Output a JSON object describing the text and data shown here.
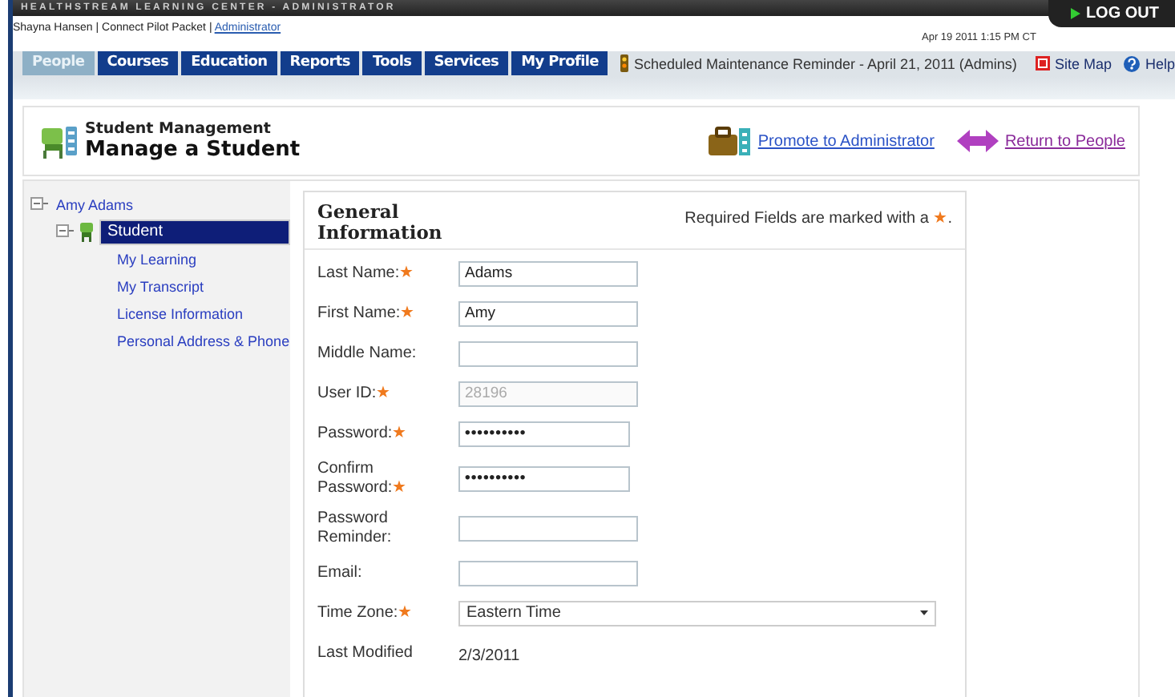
{
  "header": {
    "title": "HEALTHSTREAM LEARNING CENTER - ADMINISTRATOR",
    "user": "Shayna Hansen | Connect Pilot Packet |",
    "role_link": "Administrator",
    "datetime": "Apr 19 2011 1:15 PM CT",
    "logout": "LOG OUT"
  },
  "tabs": [
    {
      "label": "People",
      "selected": true
    },
    {
      "label": "Courses",
      "selected": false
    },
    {
      "label": "Education",
      "selected": false
    },
    {
      "label": "Reports",
      "selected": false
    },
    {
      "label": "Tools",
      "selected": false
    },
    {
      "label": "Services",
      "selected": false
    },
    {
      "label": "My Profile",
      "selected": false
    }
  ],
  "reminder": "Scheduled Maintenance Reminder - April 21, 2011 (Admins)",
  "utility_links": [
    "Site Map",
    "Help"
  ],
  "page": {
    "subtitle": "Student Management",
    "title": "Manage a Student",
    "actions": [
      "Promote to Administrator",
      "Return to People"
    ]
  },
  "tree": {
    "label": "Amy Adams",
    "selected": false,
    "expanded": true,
    "children": [
      {
        "label": "Student",
        "selected": true,
        "expanded": true,
        "children": [
          {
            "label": "My Learning",
            "selected": false
          },
          {
            "label": "My Transcript",
            "selected": false
          },
          {
            "label": "License Information",
            "selected": false
          },
          {
            "label": "Personal Address & Phone",
            "selected": false
          }
        ]
      }
    ]
  },
  "form": {
    "heading": "General Information",
    "notice": "Required Fields are marked with a",
    "notice_end": ".",
    "required_mark": "★",
    "fields": [
      {
        "kind": "text",
        "label": "Last Name:",
        "required": true,
        "value": "Adams"
      },
      {
        "kind": "text",
        "label": "First Name:",
        "required": true,
        "value": "Amy"
      },
      {
        "kind": "text",
        "label": "Middle Name:",
        "required": false
      },
      {
        "kind": "text",
        "label": "User ID:",
        "required": true,
        "value": "28196",
        "disabled": true
      },
      {
        "kind": "password",
        "label": "Password:",
        "required": true,
        "value": "••••••••••"
      },
      {
        "kind": "password",
        "label": "Confirm Password:",
        "required": true,
        "value": "••••••••••"
      },
      {
        "kind": "text",
        "label": "Password Reminder:",
        "required": false
      },
      {
        "kind": "text",
        "label": "Email:",
        "required": false
      },
      {
        "kind": "select",
        "label": "Time Zone:",
        "required": true,
        "value": "Eastern Time"
      },
      {
        "kind": "static",
        "label": "Last Modified",
        "required": false,
        "value": "2/3/2011"
      }
    ]
  }
}
